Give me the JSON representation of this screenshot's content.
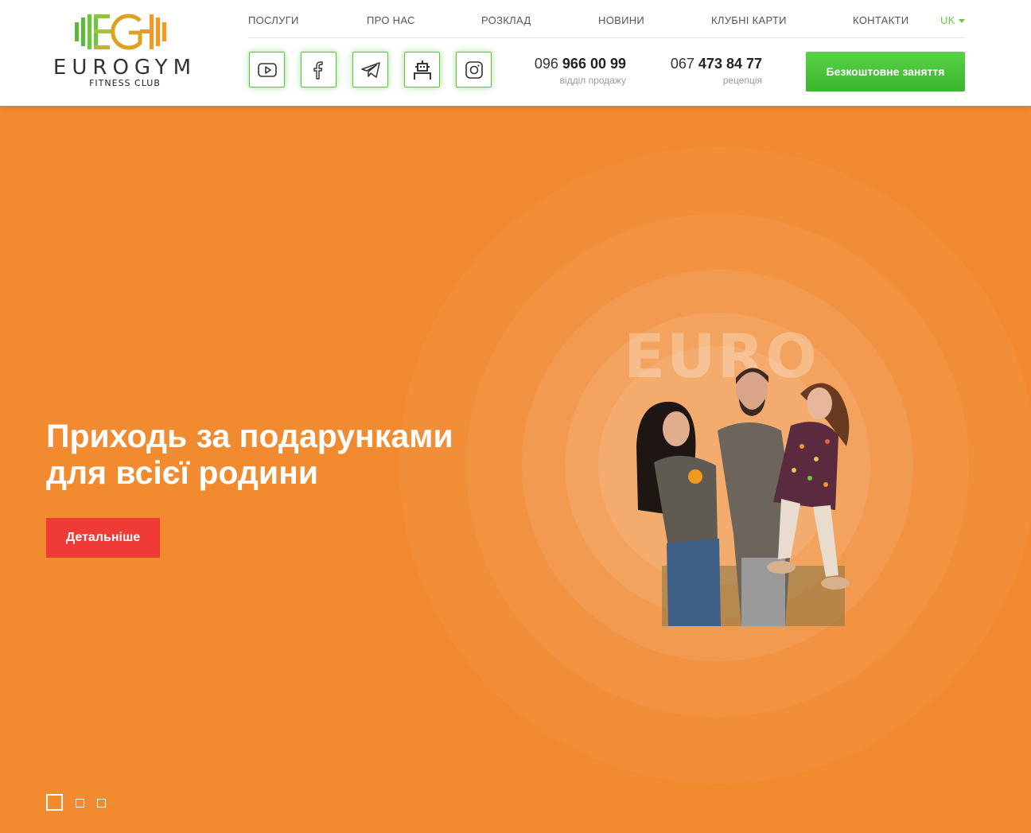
{
  "brand": {
    "mark": "EG",
    "name": "EUROGYM",
    "tagline": "FITNESS CLUB",
    "accent": "#6cc63d",
    "logo_orange": "#f29a1f"
  },
  "nav": {
    "items": [
      {
        "label": "ПОСЛУГИ"
      },
      {
        "label": "ПРО НАС"
      },
      {
        "label": "РОЗКЛАД"
      },
      {
        "label": "НОВИНИ"
      },
      {
        "label": "КЛУБНІ КАРТИ"
      },
      {
        "label": "КОНТАКТИ"
      }
    ],
    "language": "UK"
  },
  "social": [
    {
      "icon": "youtube-icon"
    },
    {
      "icon": "facebook-icon"
    },
    {
      "icon": "telegram-icon"
    },
    {
      "icon": "bot-icon"
    },
    {
      "icon": "instagram-icon"
    }
  ],
  "phones": [
    {
      "prefix": "096",
      "number": "966 00 99",
      "caption": "відділ продажу"
    },
    {
      "prefix": "067",
      "number": "473 84 77",
      "caption": "рецепція"
    }
  ],
  "cta": {
    "label": "Безкоштовне заняття",
    "color": "#4cc43a"
  },
  "hero": {
    "background": "#f28a30",
    "headline_line1": "Приходь за подарунками",
    "headline_line2": "для всієї родини",
    "button_label": "Детальніше",
    "button_color": "#f03a36",
    "bg_word": "EURO"
  },
  "slider": {
    "count": 3,
    "active": 1
  }
}
